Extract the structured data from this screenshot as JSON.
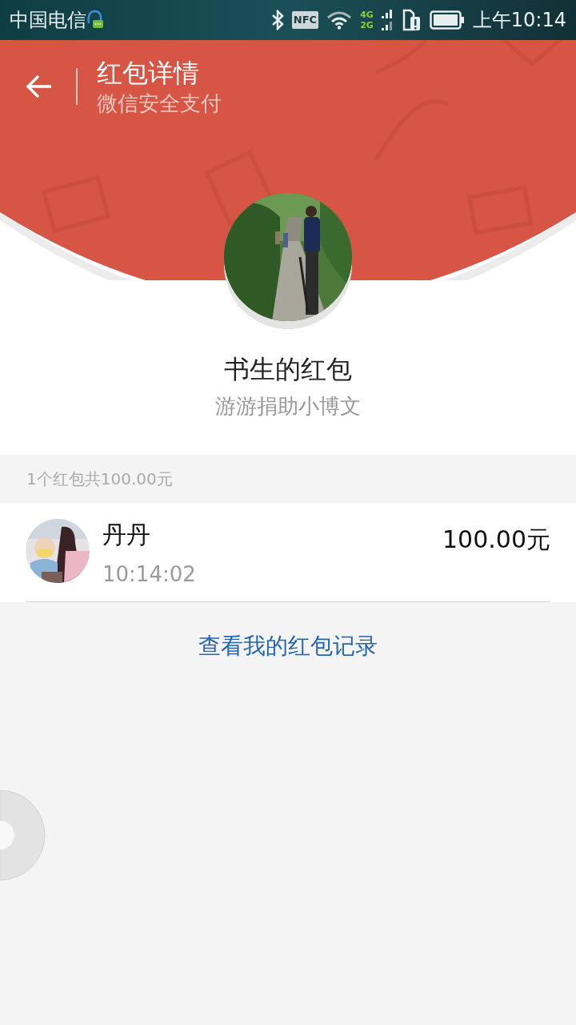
{
  "status_bar": {
    "carrier": "中国电信",
    "nfc_label": "NFC",
    "network_labels": [
      "4G",
      "2G"
    ],
    "time": "上午10:14"
  },
  "header": {
    "title": "红包详情",
    "subtitle": "微信安全支付"
  },
  "sender": {
    "name": "书生的红包",
    "message": "游游捐助小博文"
  },
  "summary": "1个红包共100.00元",
  "receivers": [
    {
      "name": "丹丹",
      "time": "10:14:02",
      "amount": "100.00元"
    }
  ],
  "record_link": "查看我的红包记录"
}
